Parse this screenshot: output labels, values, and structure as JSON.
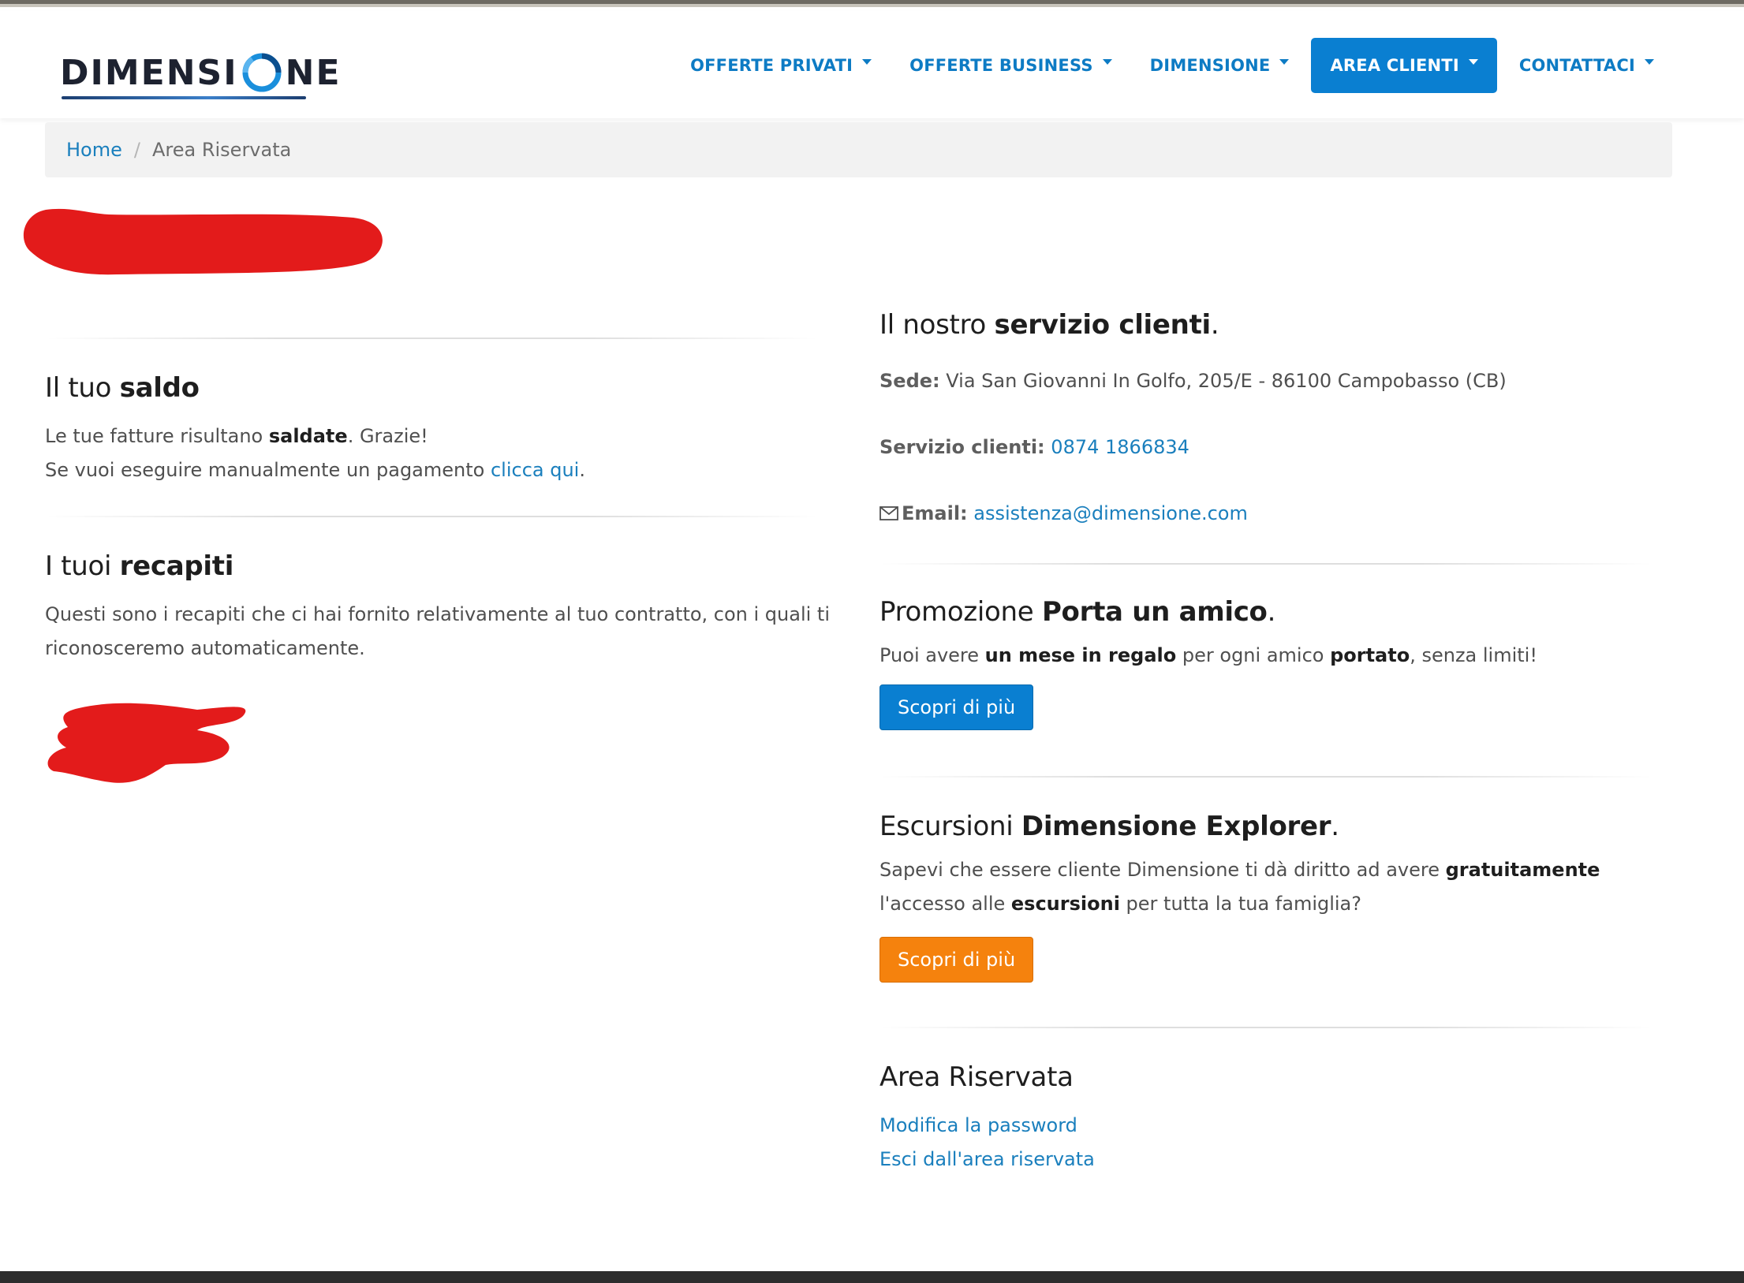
{
  "nav": {
    "logo_text": "DIMENSIONE",
    "items": [
      {
        "label": "OFFERTE PRIVATI"
      },
      {
        "label": "OFFERTE BUSINESS"
      },
      {
        "label": "DIMENSIONE"
      },
      {
        "label": "AREA CLIENTI",
        "active": true
      },
      {
        "label": "CONTATTACI"
      }
    ]
  },
  "breadcrumb": {
    "home": "Home",
    "separator": "/",
    "current": "Area Riservata"
  },
  "saldo": {
    "title_normal": "Il tuo ",
    "title_bold": "saldo",
    "line1_prefix": "Le tue fatture risultano ",
    "line1_bold": "saldate",
    "line1_suffix": ". Grazie!",
    "line2_prefix": "Se vuoi eseguire manualmente un pagamento ",
    "line2_link": "clicca qui",
    "line2_suffix": "."
  },
  "recapiti": {
    "title_normal": "I tuoi ",
    "title_bold": "recapiti",
    "text": "Questi sono i recapiti che ci hai fornito relativamente al tuo contratto, con i quali ti riconosceremo automaticamente."
  },
  "servizio": {
    "title_normal": "Il nostro ",
    "title_bold": "servizio clienti",
    "title_suffix": ".",
    "sede_label": "Sede:",
    "sede_value": "Via San Giovanni In Golfo, 205/E - 86100 Campobasso (CB)",
    "phone_label": "Servizio clienti:",
    "phone_value": "0874 1866834",
    "email_label": "Email:",
    "email_value": "assistenza@dimensione.com"
  },
  "promo": {
    "title_normal": "Promozione ",
    "title_bold": "Porta un amico",
    "title_suffix": ".",
    "text_a": "Puoi avere ",
    "text_b": "un mese in regalo",
    "text_c": " per ogni amico ",
    "text_d": "portato",
    "text_e": ", senza limiti!",
    "button": "Scopri di più"
  },
  "escursioni": {
    "title_normal": "Escursioni ",
    "title_bold": "Dimensione Explorer",
    "title_suffix": ".",
    "text_a": "Sapevi che essere cliente Dimensione ti dà diritto ad avere ",
    "text_b": "gratuitamente",
    "text_c": " l'accesso alle ",
    "text_d": "escursioni",
    "text_e": " per tutta la tua famiglia?",
    "button": "Scopri di più"
  },
  "area": {
    "title": "Area Riservata",
    "link_password": "Modifica la password",
    "link_logout": "Esci dall'area riservata"
  },
  "colors": {
    "brand_blue": "#0a7fd1",
    "link_blue": "#1a7fbd",
    "orange": "#f5820d",
    "redaction": "#e31b1b"
  }
}
